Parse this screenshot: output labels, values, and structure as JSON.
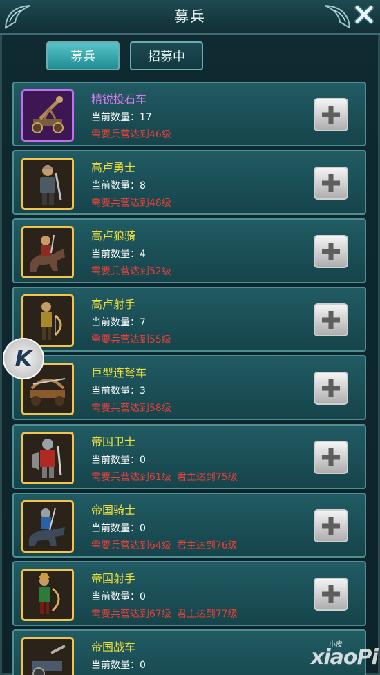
{
  "title": "募兵",
  "tabs": [
    {
      "label": "募兵",
      "active": true
    },
    {
      "label": "招募中",
      "active": false
    }
  ],
  "count_label": "当前数量：",
  "units": [
    {
      "name": "精锐投石车",
      "count": "17",
      "req": "需要兵营达到46级",
      "req2": "",
      "rarity": "purple"
    },
    {
      "name": "高卢勇士",
      "count": "8",
      "req": "需要兵营达到48级",
      "req2": "",
      "rarity": "gold"
    },
    {
      "name": "高卢狼骑",
      "count": "4",
      "req": "需要兵营达到52级",
      "req2": "",
      "rarity": "gold"
    },
    {
      "name": "高卢射手",
      "count": "7",
      "req": "需要兵营达到55级",
      "req2": "",
      "rarity": "gold"
    },
    {
      "name": "巨型连弩车",
      "count": "3",
      "req": "需要兵营达到58级",
      "req2": "",
      "rarity": "gold"
    },
    {
      "name": "帝国卫士",
      "count": "0",
      "req": "需要兵营达到61级",
      "req2": "君主达到75级",
      "rarity": "gold"
    },
    {
      "name": "帝国骑士",
      "count": "0",
      "req": "需要兵营达到64级",
      "req2": "君主达到76级",
      "rarity": "gold"
    },
    {
      "name": "帝国射手",
      "count": "0",
      "req": "需要兵营达到67级",
      "req2": "君主达到77级",
      "rarity": "gold"
    },
    {
      "name": "帝国战车",
      "count": "0",
      "req": "",
      "req2": "",
      "rarity": "gold"
    }
  ],
  "badge": {
    "letter": "K"
  },
  "watermark": {
    "small": "小皮",
    "big": "xiaoPi"
  },
  "icons": {
    "close": "close-icon",
    "add": "plus-icon"
  },
  "colors": {
    "name_gold": "#f0de38",
    "name_purple": "#d87af2",
    "requirement_red": "#ec3f37",
    "tab_active": "#3fb4ba",
    "row_bg": "#1c505a"
  }
}
